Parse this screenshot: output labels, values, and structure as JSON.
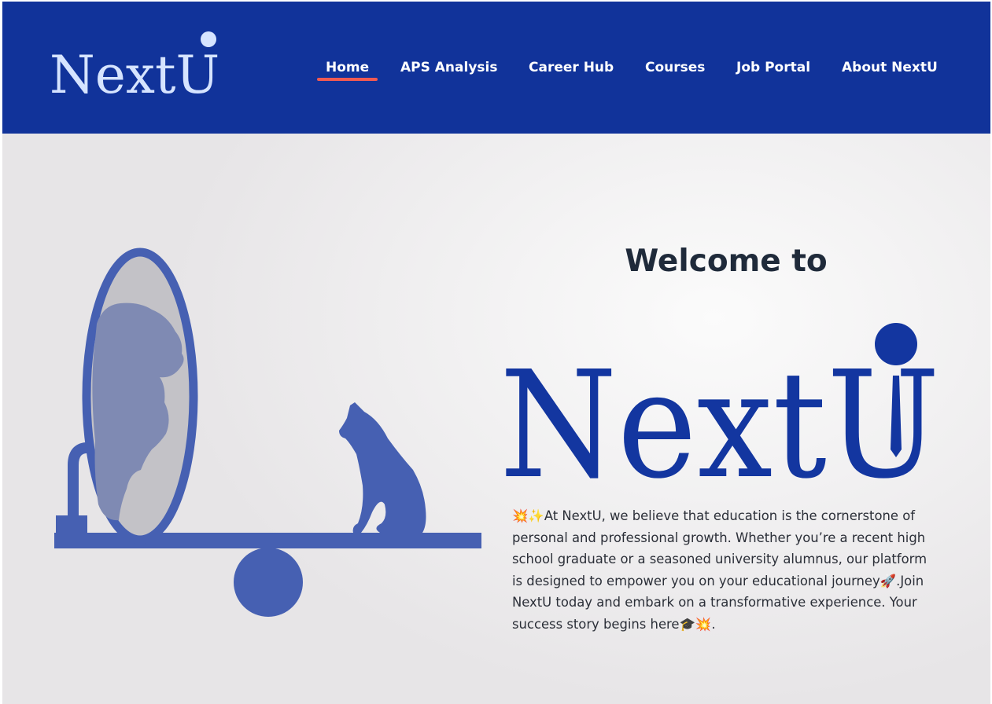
{
  "brand": {
    "logo_text": "NextU",
    "logo_color_header": "#cfe0ff",
    "logo_color_hero": "#1336a0"
  },
  "nav": {
    "background": "#11339a",
    "active_underline_color": "#f15a52",
    "items": [
      {
        "label": "Home",
        "active": true
      },
      {
        "label": "APS Analysis",
        "active": false
      },
      {
        "label": "Career Hub",
        "active": false
      },
      {
        "label": "Courses",
        "active": false
      },
      {
        "label": "Job Portal",
        "active": false
      },
      {
        "label": "About NextU",
        "active": false
      }
    ]
  },
  "hero": {
    "heading": "Welcome to",
    "intro_prefix_emoji": "💥✨",
    "intro_part1": "At NextU, we believe that education is the cornerstone of personal and professional growth. Whether you’re a recent high school graduate or a seasoned university alumnus, our platform is designed to empower you on your educational journey",
    "rocket_emoji": "🚀",
    "intro_part2": ".Join NextU today and embark on a transformative experience. Your success story begins here",
    "suffix_emoji": "🎓💥",
    "intro_end": ".",
    "illustration_icon": "cat-mirror-lion-illustration",
    "illustration_color": "#4660b2"
  }
}
